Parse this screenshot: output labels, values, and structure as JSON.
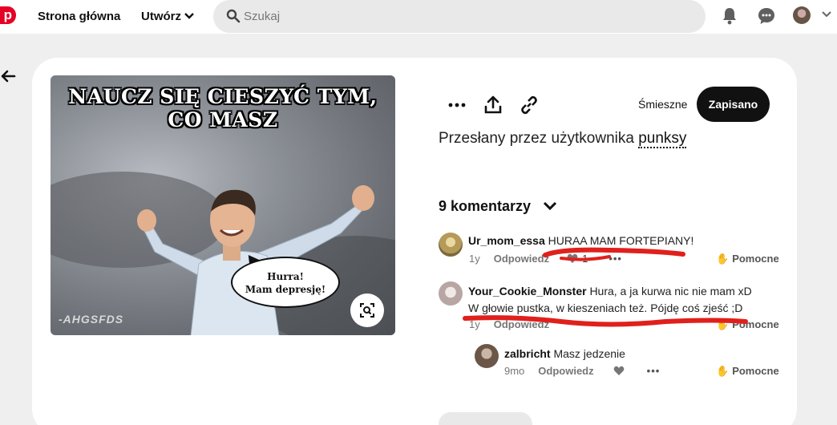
{
  "colors": {
    "brand": "#e60023",
    "accent": "#111111",
    "annotation": "#e0201c"
  },
  "header": {
    "logo_letter": "p",
    "home": "Strona główna",
    "create": "Utwórz",
    "search_placeholder": "Szukaj",
    "icons": [
      "bell-icon",
      "chat-icon",
      "avatar",
      "chevron-down-icon"
    ]
  },
  "pin": {
    "image_title_line1": "NAUCZ SIĘ CIESZYĆ TYM,",
    "image_title_line2": "CO MASZ",
    "bubble_line1": "Hurra!",
    "bubble_line2": "Mam depresję!",
    "watermark": "-AHGSFDS",
    "board": "Śmieszne",
    "save_label": "Zapisano",
    "uploaded_prefix": "Przesłany przez użytkownika",
    "uploader": "punksy",
    "comments_count": "9 komentarzy"
  },
  "comments": [
    {
      "user": "Ur_mom_essa",
      "text": "HURAA MAM FORTEPIANY!",
      "time": "1y",
      "reply": "Odpowiedz",
      "likes": "1",
      "helpful": "Pomocne"
    },
    {
      "user": "Your_Cookie_Monster",
      "text_line1": "Hura, a ja kurwa nic nie mam xD",
      "text_line2": "W głowie pustka, w kieszeniach też. Pójdę coś zjeść ;D",
      "time": "1y",
      "reply": "Odpowiedz",
      "helpful": "Pomocne"
    },
    {
      "user": "zalbricht",
      "text": "Masz jedzenie",
      "time": "9mo",
      "reply": "Odpowiedz",
      "helpful": "Pomocne"
    }
  ]
}
